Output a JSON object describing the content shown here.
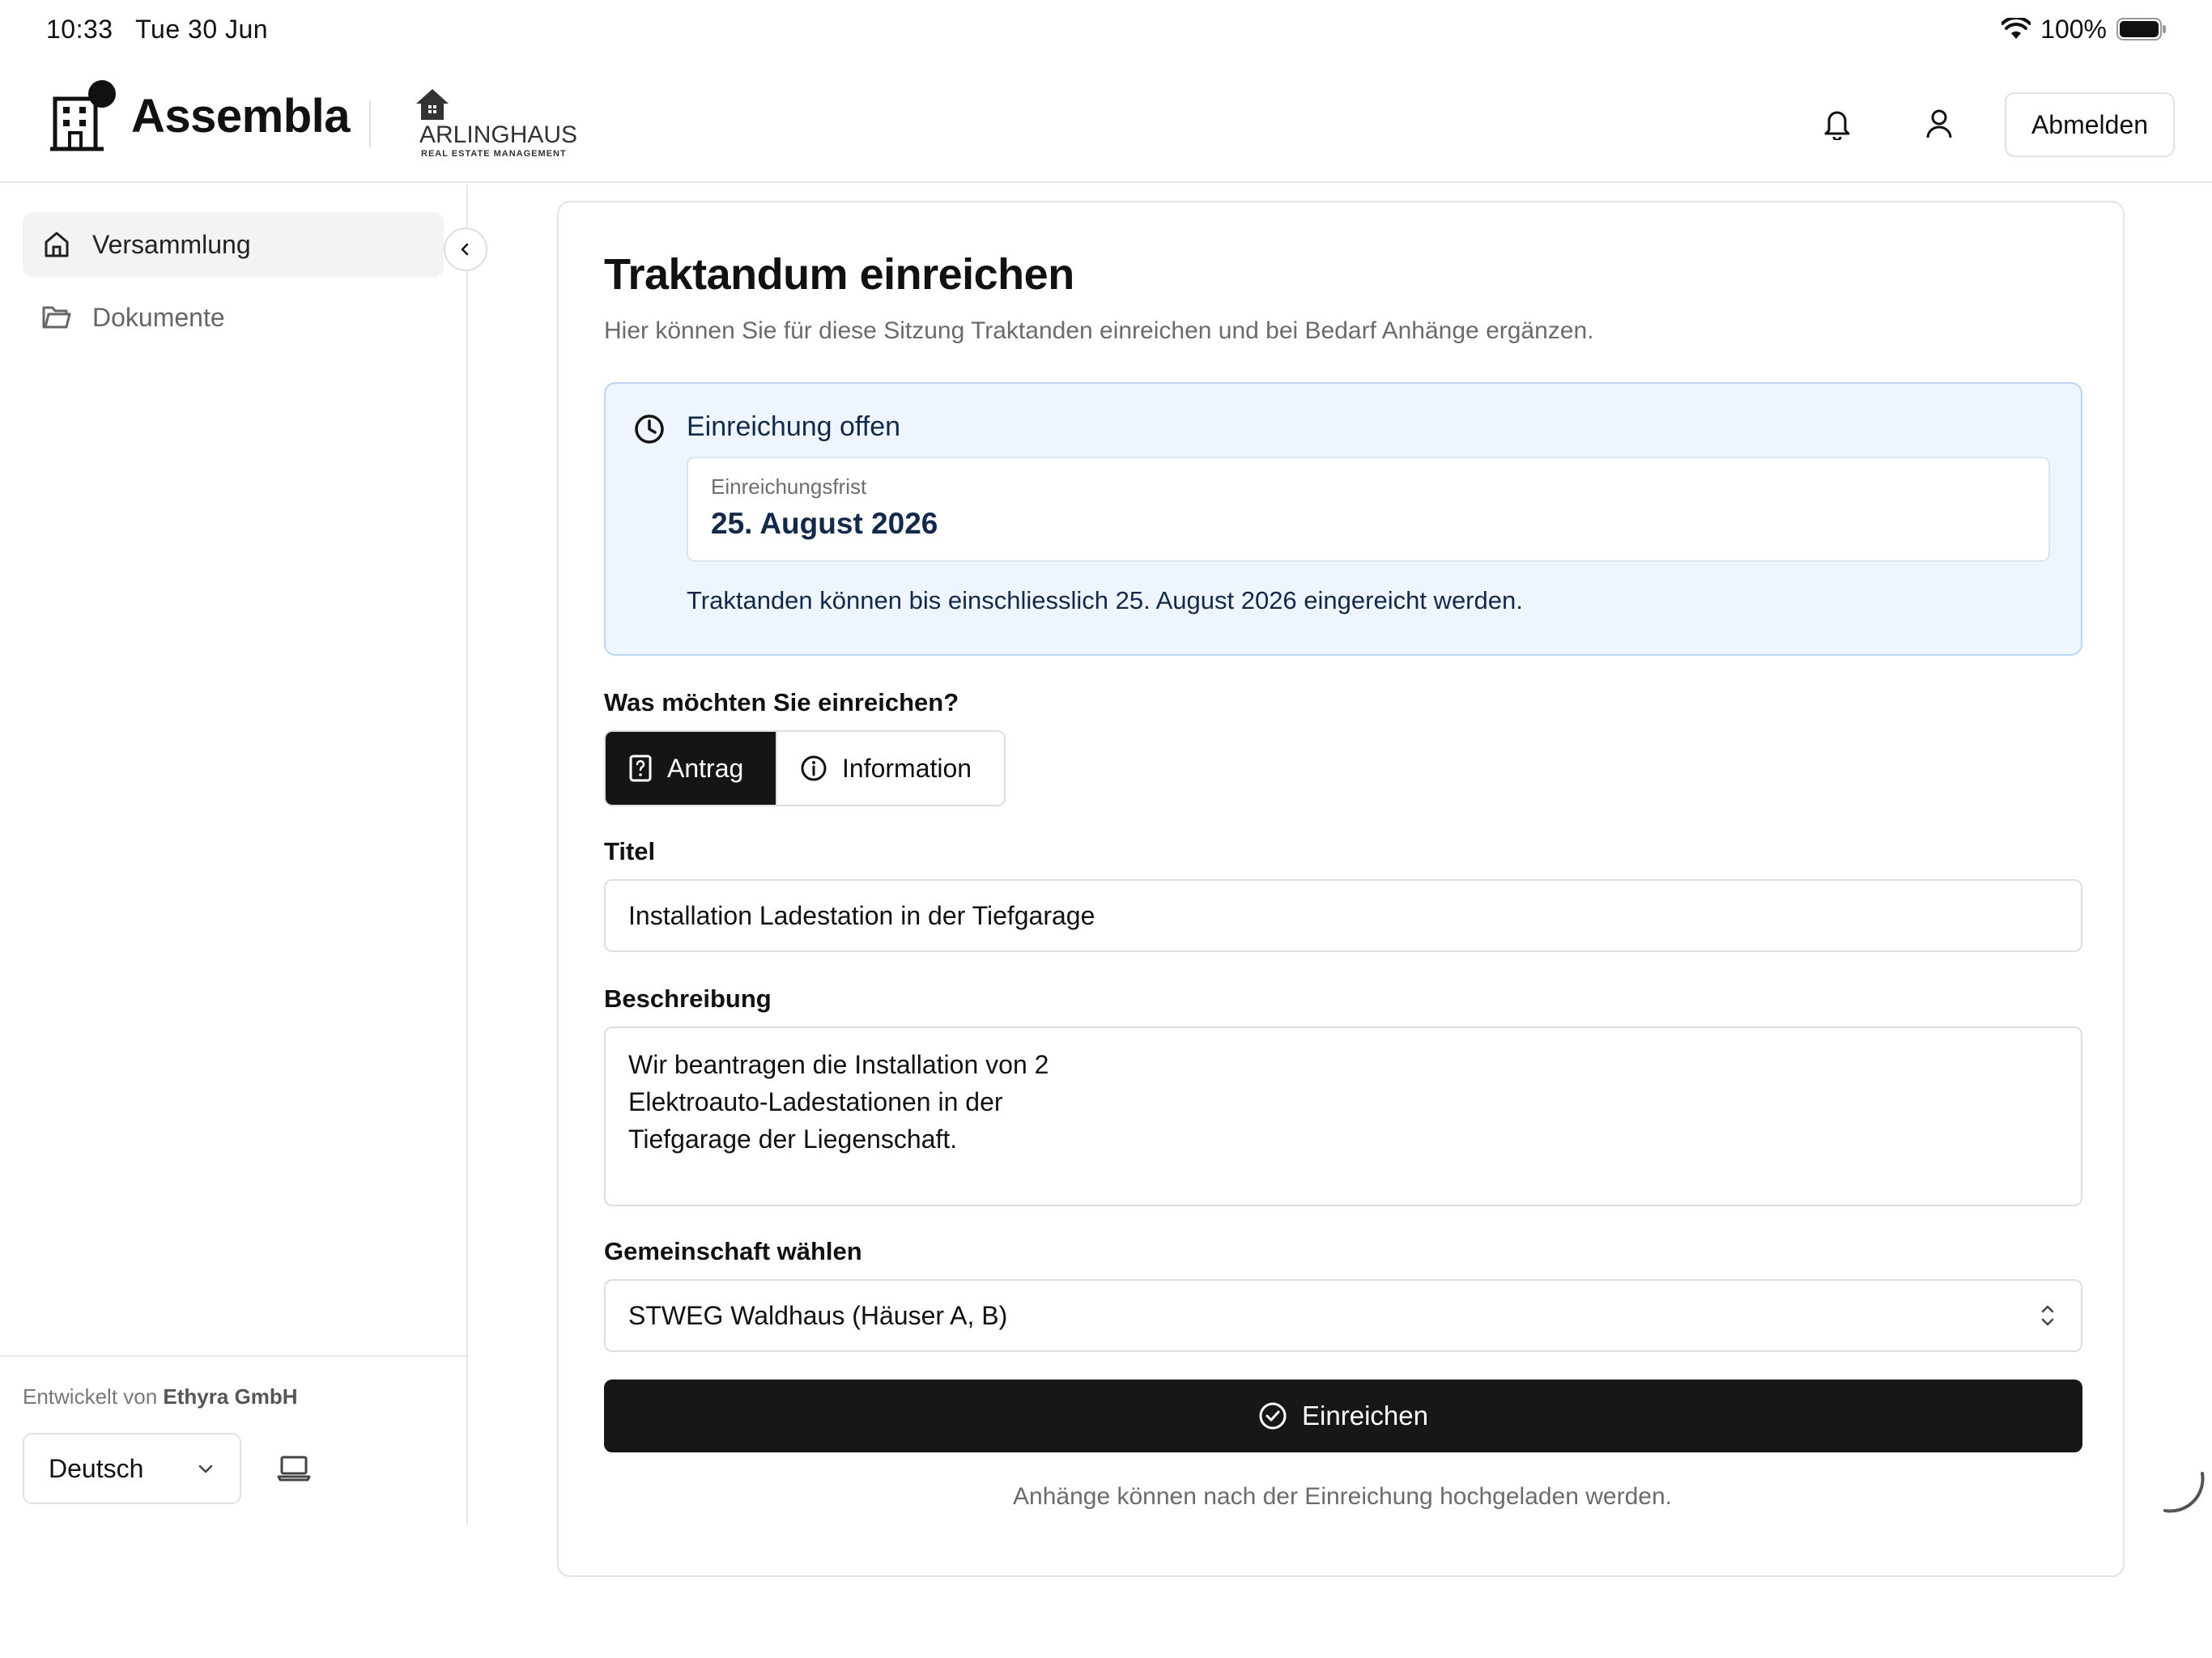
{
  "status_bar": {
    "time": "10:33",
    "date": "Tue 30 Jun",
    "battery": "100%"
  },
  "header": {
    "app_name": "Assembla",
    "partner_name": "ARLINGHAUS",
    "partner_tagline": "REAL ESTATE MANAGEMENT",
    "logout_label": "Abmelden",
    "icons": [
      "bell-icon",
      "user-icon"
    ]
  },
  "sidebar": {
    "items": [
      {
        "label": "Versammlung",
        "icon": "home-icon",
        "active": true
      },
      {
        "label": "Dokumente",
        "icon": "folder-icon",
        "active": false
      }
    ],
    "developed_by_prefix": "Entwickelt von",
    "developed_by_company": "Ethyra GmbH",
    "language": "Deutsch"
  },
  "main": {
    "title": "Traktandum einreichen",
    "subtitle": "Hier können Sie für diese Sitzung Traktanden einreichen und bei Bedarf Anhänge ergänzen.",
    "info": {
      "title": "Einreichung offen",
      "deadline_label": "Einreichungsfrist",
      "deadline_value": "25. August 2026",
      "note": "Traktanden können bis einschliesslich 25. August 2026 eingereicht werden."
    },
    "type_question": "Was möchten Sie einreichen?",
    "type_options": [
      {
        "label": "Antrag",
        "selected": true
      },
      {
        "label": "Information",
        "selected": false
      }
    ],
    "title_label": "Titel",
    "title_value": "Installation Ladestation in der Tiefgarage",
    "description_label": "Beschreibung",
    "description_value": "Wir beantragen die Installation von 2\nElektroauto-Ladestationen in der\nTiefgarage der Liegenschaft.",
    "community_label": "Gemeinschaft wählen",
    "community_value": "STWEG Waldhaus (Häuser A, B)",
    "submit_label": "Einreichen",
    "footer_note": "Anhänge können nach der Einreichung hochgeladen werden."
  },
  "colors": {
    "primary": "#151515",
    "info_bg": "#eef5fe",
    "info_border": "#bcd6f6",
    "info_text": "#13294a"
  }
}
